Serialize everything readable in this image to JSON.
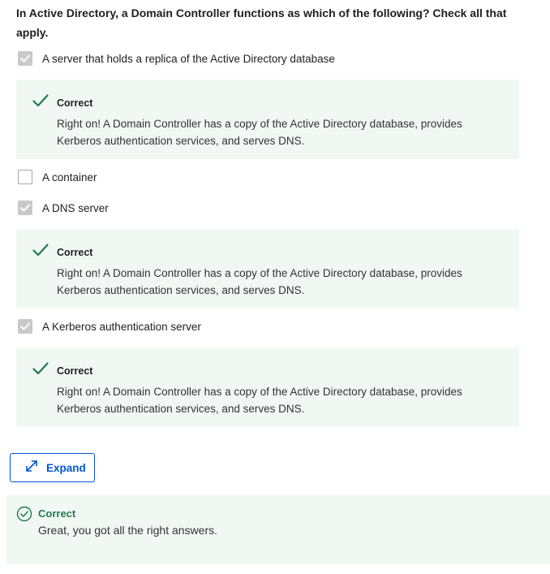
{
  "question": {
    "text": "In Active Directory, a Domain Controller functions as which of the following? Check all that apply."
  },
  "options": [
    {
      "label": "A server that holds a replica of the Active Directory database",
      "checked": true
    },
    {
      "label": "A container",
      "checked": false
    },
    {
      "label": "A DNS server",
      "checked": true
    },
    {
      "label": "A Kerberos authentication server",
      "checked": true
    }
  ],
  "feedback": [
    {
      "title": "Correct",
      "text": "Right on! A Domain Controller has a copy of the Active Directory database, provides Kerberos authentication services, and serves DNS."
    },
    {
      "title": "Correct",
      "text": "Right on! A Domain Controller has a copy of the Active Directory database, provides Kerberos authentication services, and serves DNS."
    },
    {
      "title": "Correct",
      "text": "Right on! A Domain Controller has a copy of the Active Directory database, provides Kerberos authentication services, and serves DNS."
    }
  ],
  "expand_button": {
    "label": "Expand"
  },
  "result": {
    "title": "Correct",
    "text": "Great, you got all the right answers."
  },
  "colors": {
    "accent_blue": "#0056d2",
    "success_green": "#1f7a4d",
    "feedback_bg": "#f1f8f4",
    "checkbox_checked": "#c9c9c9"
  }
}
